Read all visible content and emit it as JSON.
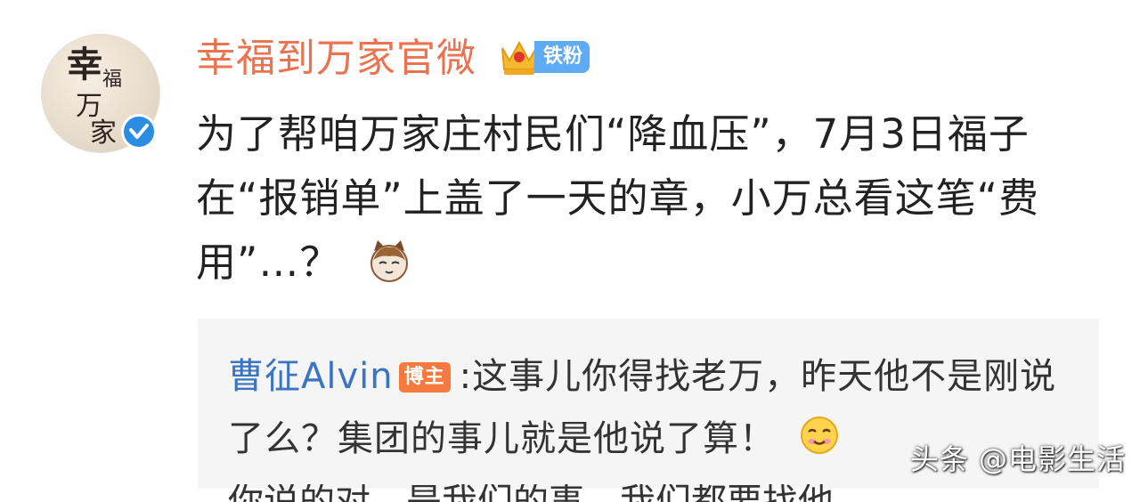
{
  "post": {
    "avatar_art": {
      "c1": "幸",
      "c2": "福",
      "c3": "万",
      "c4": "家"
    },
    "author_name": "幸福到万家官微",
    "fan_badge": "铁粉",
    "text": "为了帮咱万家庄村民们“降血压”，7月3日福子在“报销单”上盖了一天的章，小万总看这笔“费用”…？",
    "emoji": "cat-emoji"
  },
  "repost": {
    "author": "曹征Alvin",
    "badge": "博主",
    "text": ":这事儿你得找老万，昨天他不是刚说了么？集团的事儿就是他说了算！",
    "emoji": "smile-emoji",
    "partial_next_line": "你说的对，是我们的事，我们都要找他"
  },
  "watermark": "头条 @电影生活",
  "colors": {
    "name": "#eb7350",
    "link": "#3a74c2",
    "verified": "#2b8ce6",
    "fan_badge": "#5eaaf4",
    "blogger_badge": "#f47a3f",
    "repost_bg": "#f5f5f5"
  }
}
